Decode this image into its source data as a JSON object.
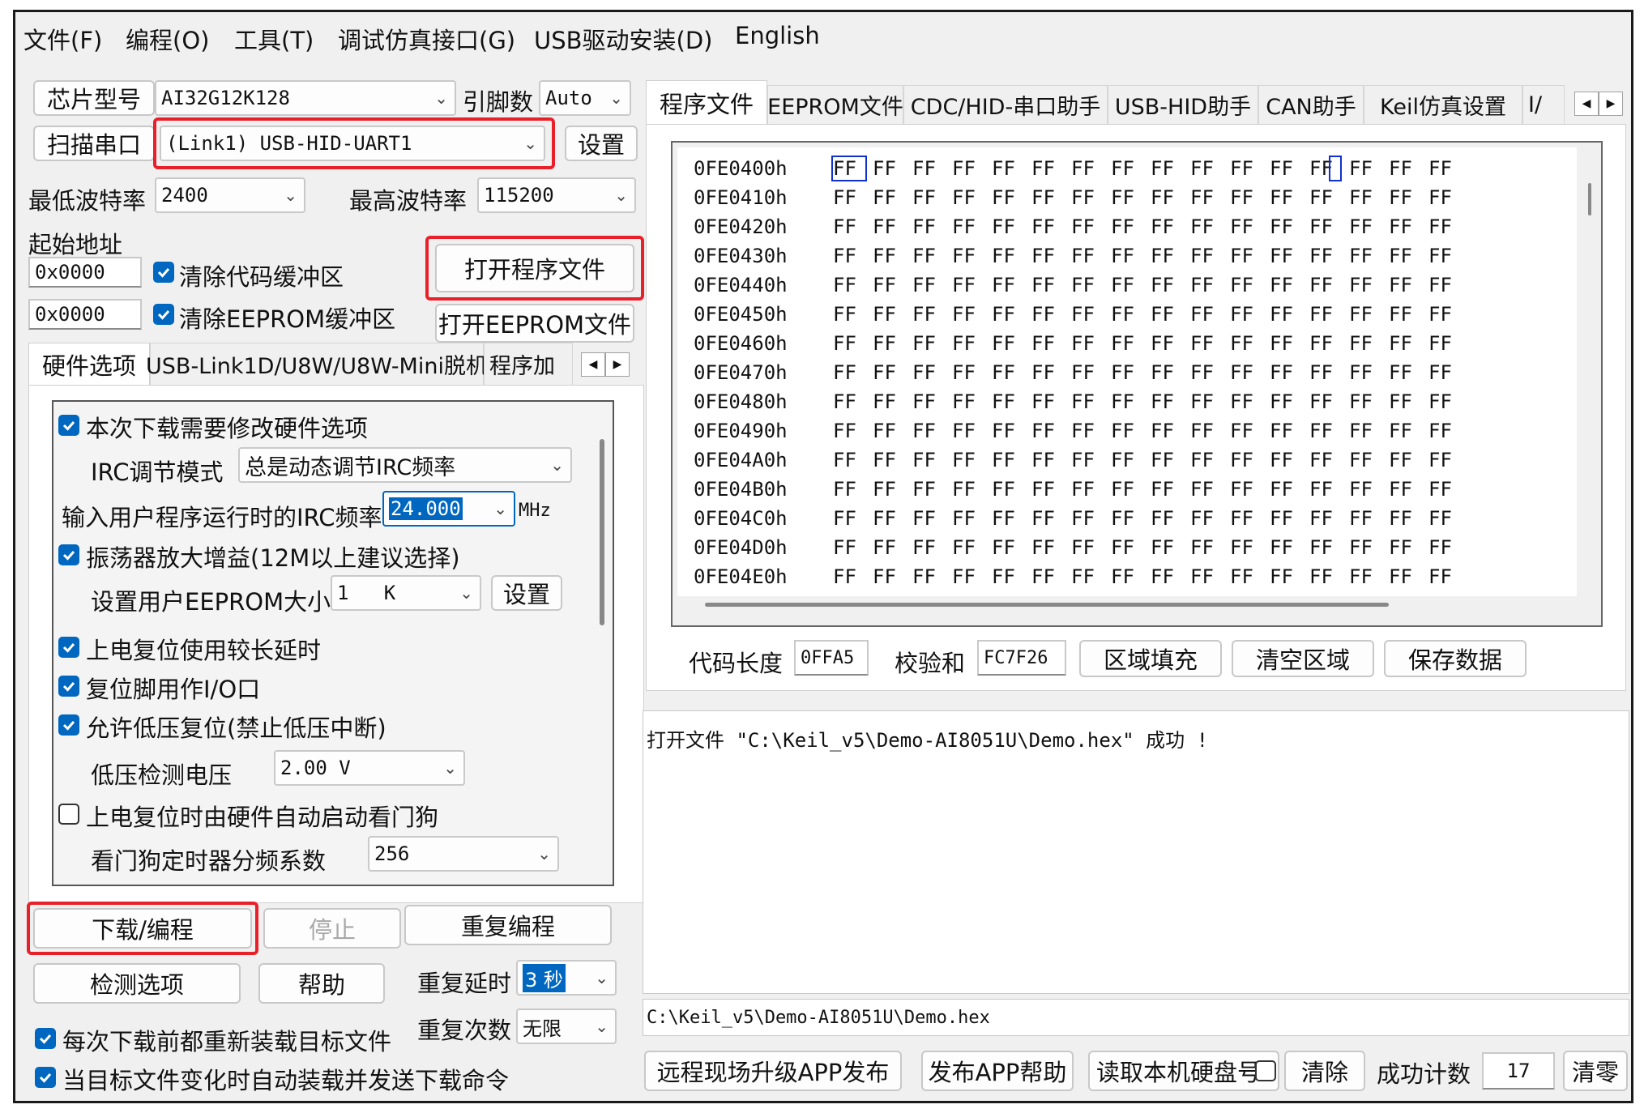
{
  "menu": {
    "items": [
      "文件(F)",
      "编程(O)",
      "工具(T)",
      "调试仿真接口(G)",
      "USB驱动安装(D)",
      "English"
    ]
  },
  "chip": {
    "label": "芯片型号",
    "value": "AI32G12K128",
    "pins_label": "引脚数",
    "pins_value": "Auto"
  },
  "port": {
    "scan_button": "扫描串口",
    "value": "(Link1) USB-HID-UART1",
    "settings_button": "设置"
  },
  "baud": {
    "min_label": "最低波特率",
    "min_value": "2400",
    "max_label": "最高波特率",
    "max_value": "115200"
  },
  "address": {
    "label": "起始地址",
    "code_value": "0x0000",
    "clear_code_label": "清除代码缓冲区",
    "open_program_button": "打开程序文件",
    "eeprom_value": "0x0000",
    "clear_eeprom_label": "清除EEPROM缓冲区",
    "open_eeprom_button": "打开EEPROM文件"
  },
  "left_tabs": [
    "硬件选项",
    "USB-Link1D/U8W/U8W-Mini脱机",
    "程序加"
  ],
  "hardware": {
    "modify_options": "本次下载需要修改硬件选项",
    "irc_mode_label": "IRC调节模式",
    "irc_mode_value": "总是动态调节IRC频率",
    "irc_freq_label": "输入用户程序运行时的IRC频率",
    "irc_freq_value": "24.000",
    "irc_freq_unit": "MHz",
    "osc_gain": "振荡器放大增益(12M以上建议选择)",
    "eeprom_size_label": "设置用户EEPROM大小",
    "eeprom_size_value": "1   K",
    "eeprom_size_button": "设置",
    "long_delay": "上电复位使用较长延时",
    "reset_pin_io": "复位脚用作I/O口",
    "low_voltage_reset": "允许低压复位(禁止低压中断)",
    "lvd_label": "低压检测电压",
    "lvd_value": "2.00 V",
    "watchdog_auto": "上电复位时由硬件自动启动看门狗",
    "wdt_div_label": "看门狗定时器分频系数",
    "wdt_div_value": "256"
  },
  "actions": {
    "download": "下载/编程",
    "stop": "停止",
    "repeat": "重复编程",
    "check_options": "检测选项",
    "help": "帮助",
    "repeat_delay_label": "重复延时",
    "repeat_delay_value": "3 秒",
    "repeat_count_label": "重复次数",
    "repeat_count_value": "无限",
    "reload_each": "每次下载前都重新装载目标文件",
    "auto_reload": "当目标文件变化时自动装载并发送下载命令"
  },
  "right_tabs": [
    "程序文件",
    "EEPROM文件",
    "CDC/HID-串口助手",
    "USB-HID助手",
    "CAN助手",
    "Keil仿真设置",
    "I/"
  ],
  "hex": {
    "addresses": [
      "0FE0400h",
      "0FE0410h",
      "0FE0420h",
      "0FE0430h",
      "0FE0440h",
      "0FE0450h",
      "0FE0460h",
      "0FE0470h",
      "0FE0480h",
      "0FE0490h",
      "0FE04A0h",
      "0FE04B0h",
      "0FE04C0h",
      "0FE04D0h",
      "0FE04E0h"
    ],
    "byte": "FF"
  },
  "code_info": {
    "length_label": "代码长度",
    "length_value": "0FFA5",
    "checksum_label": "校验和",
    "checksum_value": "FC7F26",
    "fill_button": "区域填充",
    "clear_button": "清空区域",
    "save_button": "保存数据"
  },
  "log": {
    "message": "打开文件 \"C:\\Keil_v5\\Demo-AI8051U\\Demo.hex\" 成功 !",
    "path": "C:\\Keil_v5\\Demo-AI8051U\\Demo.hex"
  },
  "bottom": {
    "remote_upgrade": "远程现场升级APP发布",
    "publish_help": "发布APP帮助",
    "read_disk": "读取本机硬盘号",
    "clear": "清除",
    "success_label": "成功计数",
    "success_value": "17",
    "reset_count": "清零"
  },
  "colors": {
    "accent": "#0067c0",
    "highlight": "#e8202a"
  }
}
